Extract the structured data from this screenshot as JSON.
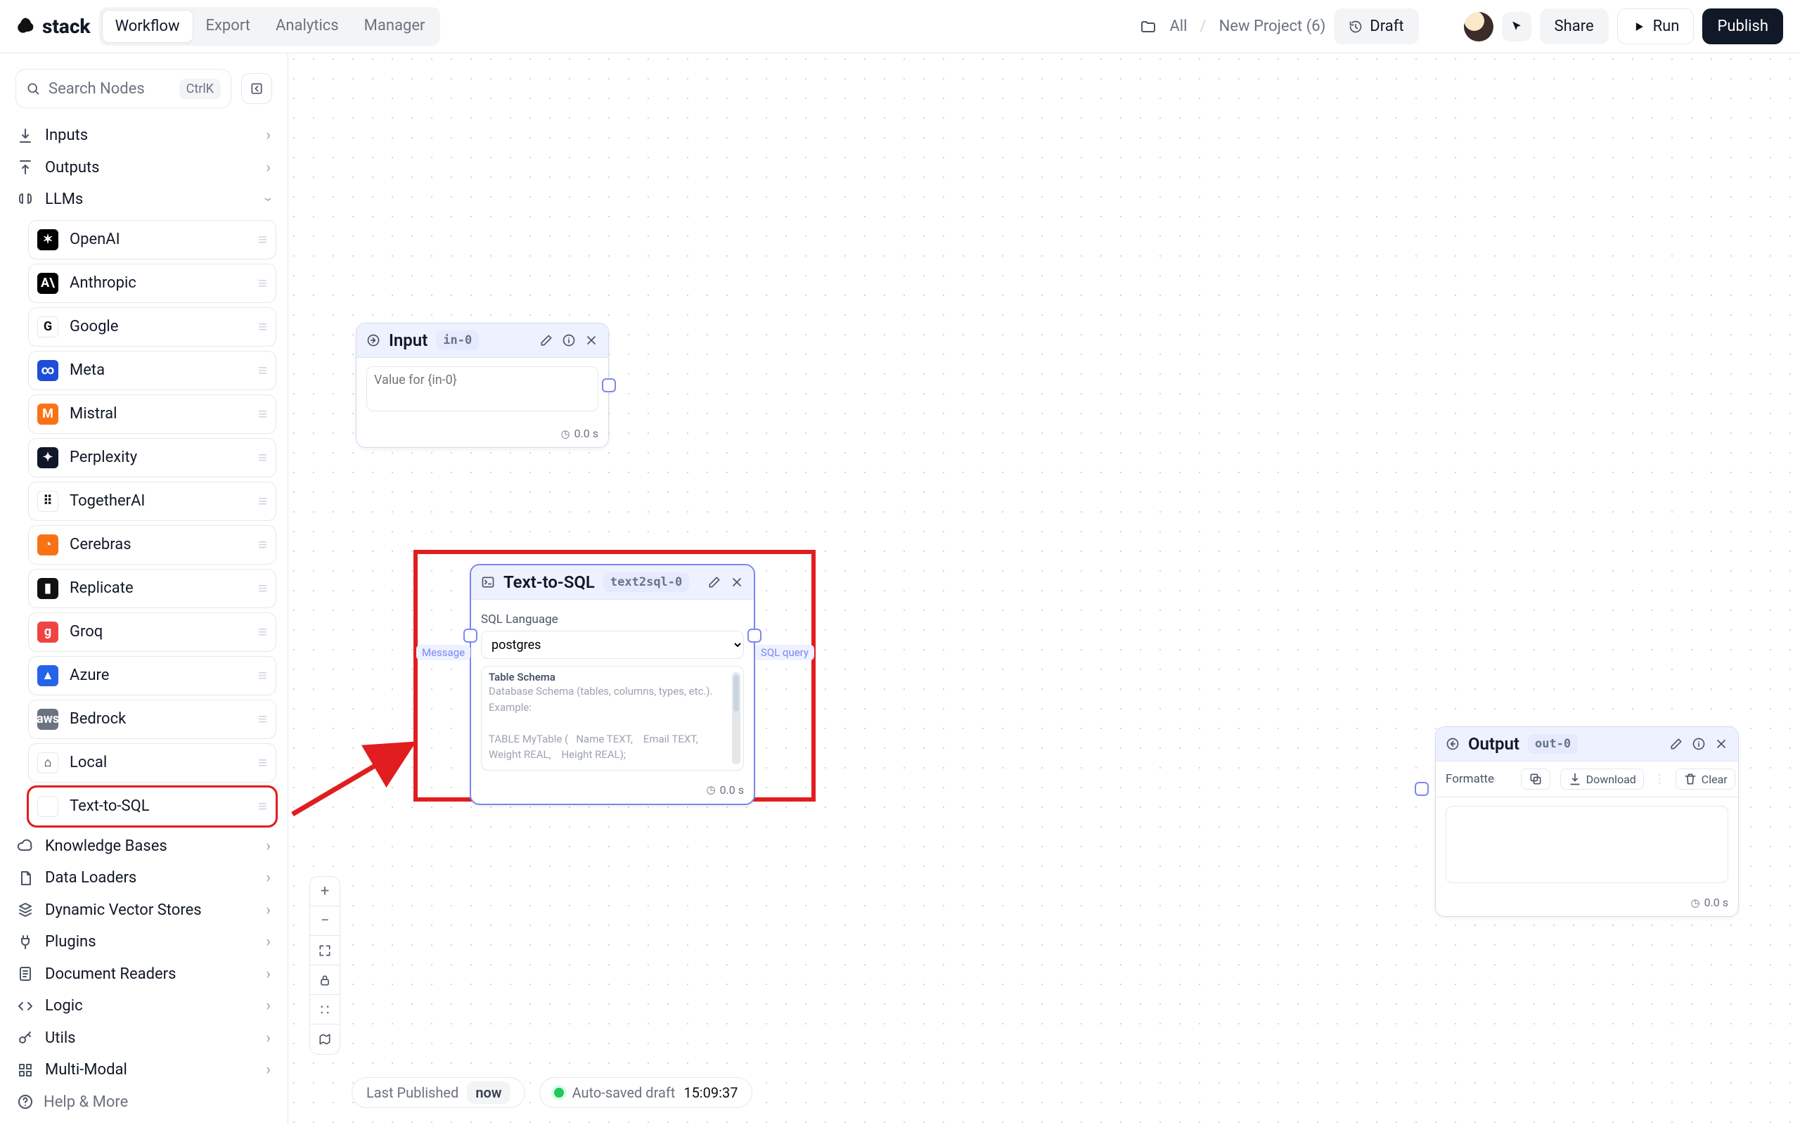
{
  "header": {
    "brand": "stack",
    "tabs": [
      "Workflow",
      "Export",
      "Analytics",
      "Manager"
    ],
    "active_tab": 0,
    "crumbs": {
      "root": "All",
      "project": "New Project (6)"
    },
    "draft_label": "Draft",
    "share_label": "Share",
    "run_label": "Run",
    "publish_label": "Publish"
  },
  "sidebar": {
    "search_placeholder": "Search Nodes",
    "search_shortcut": "CtrlK",
    "categories": [
      {
        "name": "Inputs",
        "expanded": false
      },
      {
        "name": "Outputs",
        "expanded": false
      },
      {
        "name": "LLMs",
        "expanded": true,
        "items": [
          {
            "label": "OpenAI",
            "icon": "openai"
          },
          {
            "label": "Anthropic",
            "icon": "anthropic"
          },
          {
            "label": "Google",
            "icon": "google"
          },
          {
            "label": "Meta",
            "icon": "meta"
          },
          {
            "label": "Mistral",
            "icon": "mistral"
          },
          {
            "label": "Perplexity",
            "icon": "perplexity"
          },
          {
            "label": "TogetherAI",
            "icon": "together"
          },
          {
            "label": "Cerebras",
            "icon": "cerebras"
          },
          {
            "label": "Replicate",
            "icon": "replicate"
          },
          {
            "label": "Groq",
            "icon": "groq"
          },
          {
            "label": "Azure",
            "icon": "azure"
          },
          {
            "label": "Bedrock",
            "icon": "bedrock"
          },
          {
            "label": "Local",
            "icon": "local"
          },
          {
            "label": "Text-to-SQL",
            "icon": "code",
            "highlight": true
          }
        ]
      },
      {
        "name": "Knowledge Bases",
        "expanded": false
      },
      {
        "name": "Data Loaders",
        "expanded": false
      },
      {
        "name": "Dynamic Vector Stores",
        "expanded": false
      },
      {
        "name": "Plugins",
        "expanded": false
      },
      {
        "name": "Document Readers",
        "expanded": false
      },
      {
        "name": "Logic",
        "expanded": false
      },
      {
        "name": "Utils",
        "expanded": false
      },
      {
        "name": "Multi-Modal",
        "expanded": false
      }
    ],
    "help_label": "Help & More"
  },
  "canvas": {
    "input_node": {
      "title": "Input",
      "id": "in-0",
      "placeholder": "Value for {in-0}",
      "time": "0.0 s"
    },
    "text2sql": {
      "title": "Text-to-SQL",
      "id": "text2sql-0",
      "sql_label": "SQL Language",
      "sql_value": "postgres",
      "schema_title": "Table Schema",
      "schema_placeholder": "Database Schema (tables, columns, types, etc.).\nExample:\n\nTABLE MyTable (   Name TEXT,    Email TEXT,   Weight REAL,    Height REAL);",
      "in_port": "Message",
      "out_port": "SQL query",
      "time": "0.0 s"
    },
    "output_node": {
      "title": "Output",
      "id": "out-0",
      "formatted_label": "Formatted",
      "download_label": "Download",
      "clear_label": "Clear",
      "time": "0.0 s"
    },
    "status": {
      "pub_label": "Last Published",
      "pub_value": "now",
      "auto_label": "Auto-saved draft",
      "auto_time": "15:09:37"
    }
  }
}
